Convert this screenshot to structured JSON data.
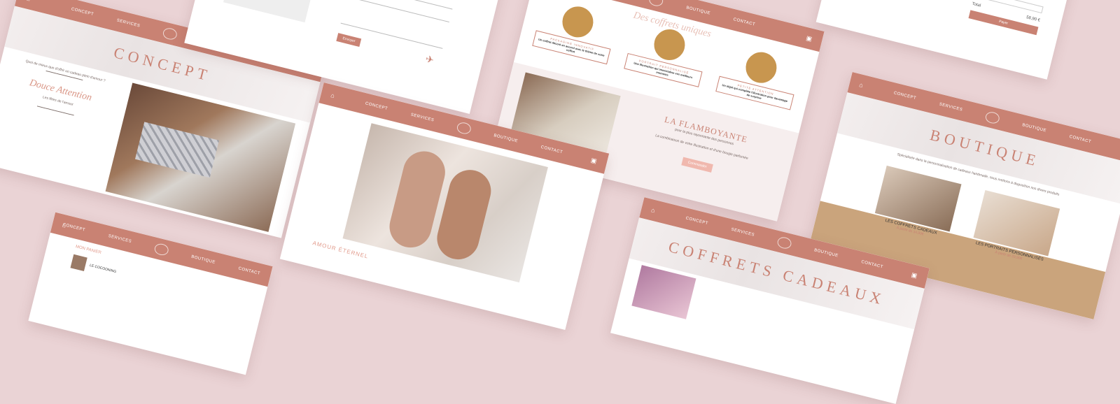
{
  "nav": {
    "concept": "CONCEPT",
    "services": "SERVICES",
    "boutique": "BOUTIQUE",
    "contact": "CONTACT"
  },
  "concept_card": {
    "title": "CONCEPT",
    "question": "Quoi de mieux que d'offrir un cadeau plein d'amour ?",
    "brand": "Douce Attention",
    "tagline": "Les fêtes de l'amour"
  },
  "contact_card": {
    "submit": "Envoyer"
  },
  "coffrets_top": {
    "script_title": "Des coffrets uniques",
    "items": [
      {
        "label": "PACKAGING INNOVATIF",
        "desc": "Un coffret décoré en accord avec le thème de votre coffret"
      },
      {
        "label": "PORTRAIT PERSONNALISÉ",
        "desc": "Une illustration qui immortalise vos meilleurs moments"
      },
      {
        "label": "PETITE ATTENTION",
        "desc": "Un objet qui complète l'illustration pour davantage de surprise"
      }
    ],
    "product_title": "LA FLAMBOYANTE",
    "product_sub": "pour la plus rayonnante des personnes",
    "product_desc": "La combinaison de votre illustration et d'une bougie parfumée",
    "cta": "Commander"
  },
  "cart_card": {
    "total_label": "Total",
    "total_value": "58,90 €",
    "pay": "Payer"
  },
  "boutique_card": {
    "title": "BOUTIQUE",
    "intro": "Spécialisée dans la personnalisation de cadeaux handmade, nous mettons à disposition nos divers produits",
    "coffrets_label": "LES COFFRETS CADEAUX",
    "coffrets_price": "À partir de 34,90€",
    "portraits_label": "LES PORTRAITS PERSONNALISÉS",
    "portraits_price": "À partir de 29,90€"
  },
  "center_card": {
    "section": "AMOUR ÉTERNEL"
  },
  "bottom_left_card": {
    "section": "MON PANIER",
    "item": "LE COCOONING"
  },
  "coffrets_bottom": {
    "title": "COFFRETS CADEAUX"
  },
  "colors": {
    "accent": "#c98273",
    "background": "#ead3d5",
    "gold": "#c8964f"
  }
}
